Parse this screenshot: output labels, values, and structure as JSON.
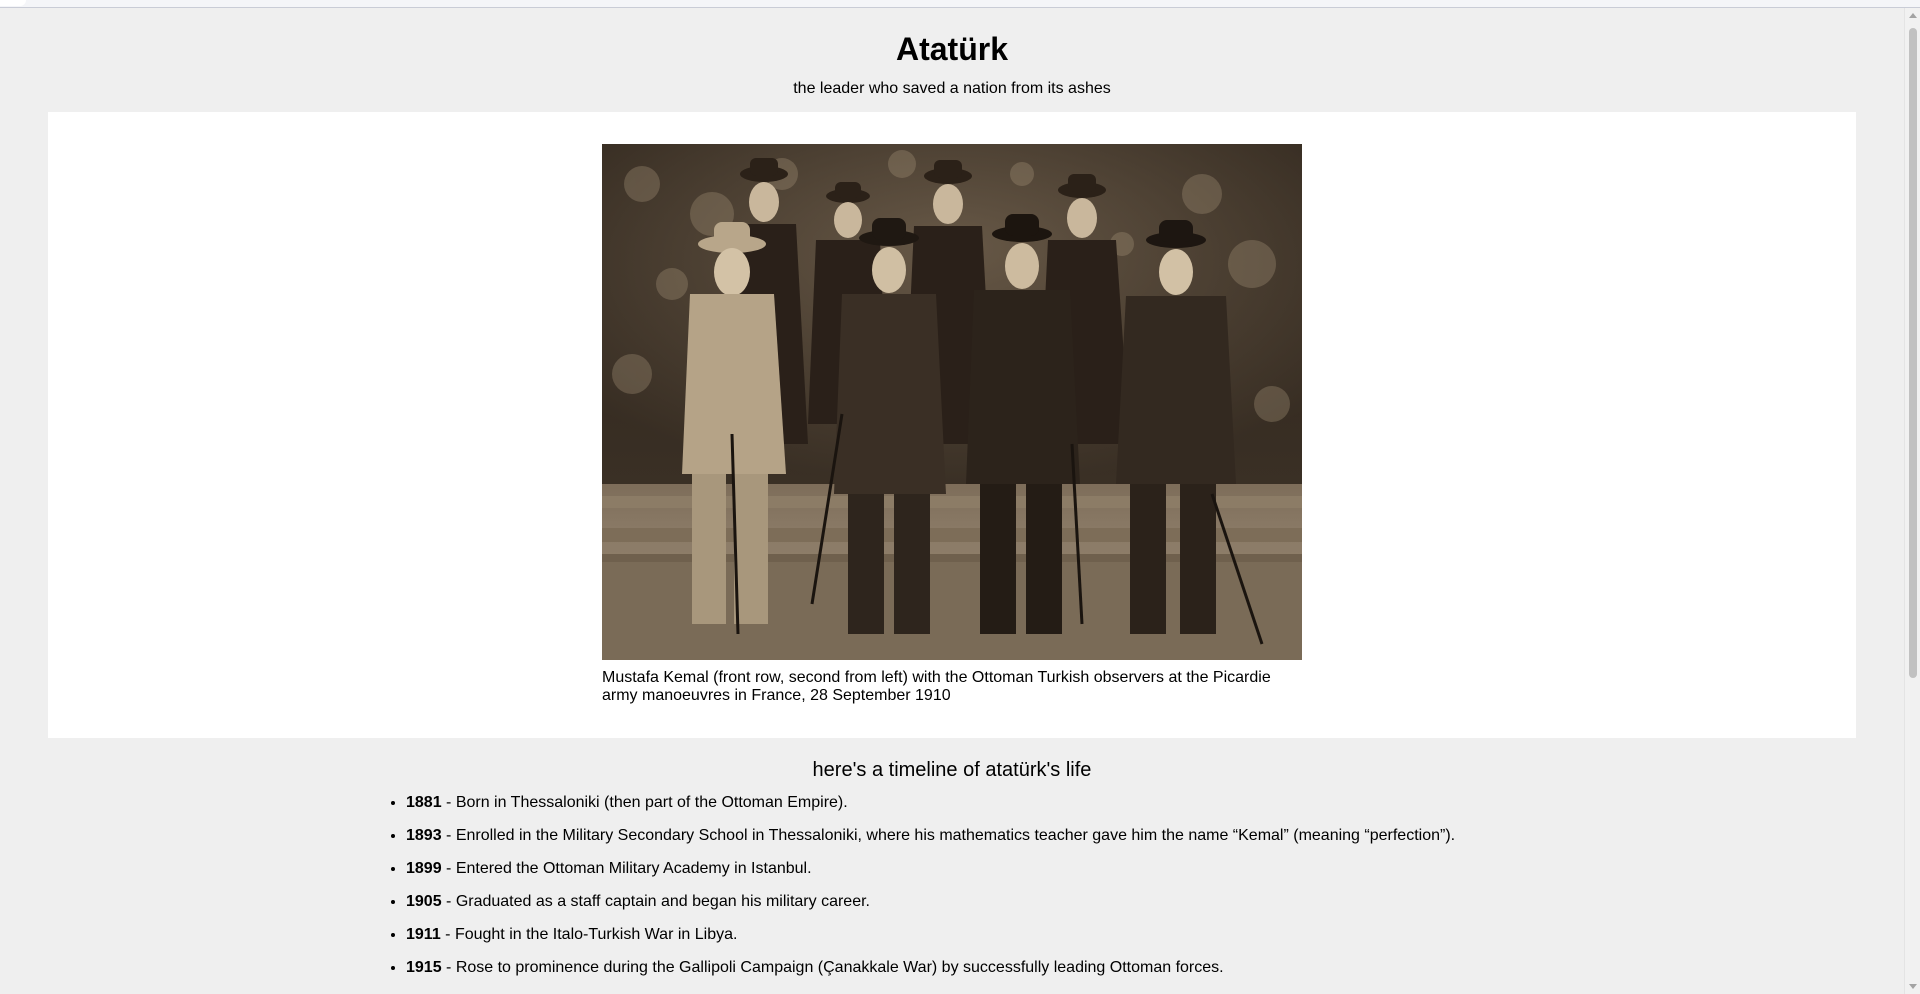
{
  "page": {
    "title": "Atatürk",
    "subtitle": "the leader who saved a nation from its ashes"
  },
  "figure": {
    "caption": "Mustafa Kemal (front row, second from left) with the Ottoman Turkish observers at the Picardie army manoeuvres in France, 28 September 1910"
  },
  "timeline": {
    "title": "here's a timeline of atatürk's life",
    "separator": " - ",
    "items": [
      {
        "year": "1881",
        "text": "Born in Thessaloniki (then part of the Ottoman Empire)."
      },
      {
        "year": "1893",
        "text": "Enrolled in the Military Secondary School in Thessaloniki, where his mathematics teacher gave him the name “Kemal” (meaning “perfection”)."
      },
      {
        "year": "1899",
        "text": "Entered the Ottoman Military Academy in Istanbul."
      },
      {
        "year": "1905",
        "text": "Graduated as a staff captain and began his military career."
      },
      {
        "year": "1911",
        "text": "Fought in the Italo-Turkish War in Libya."
      },
      {
        "year": "1915",
        "text": "Rose to prominence during the Gallipoli Campaign (Çanakkale War) by successfully leading Ottoman forces."
      }
    ]
  }
}
